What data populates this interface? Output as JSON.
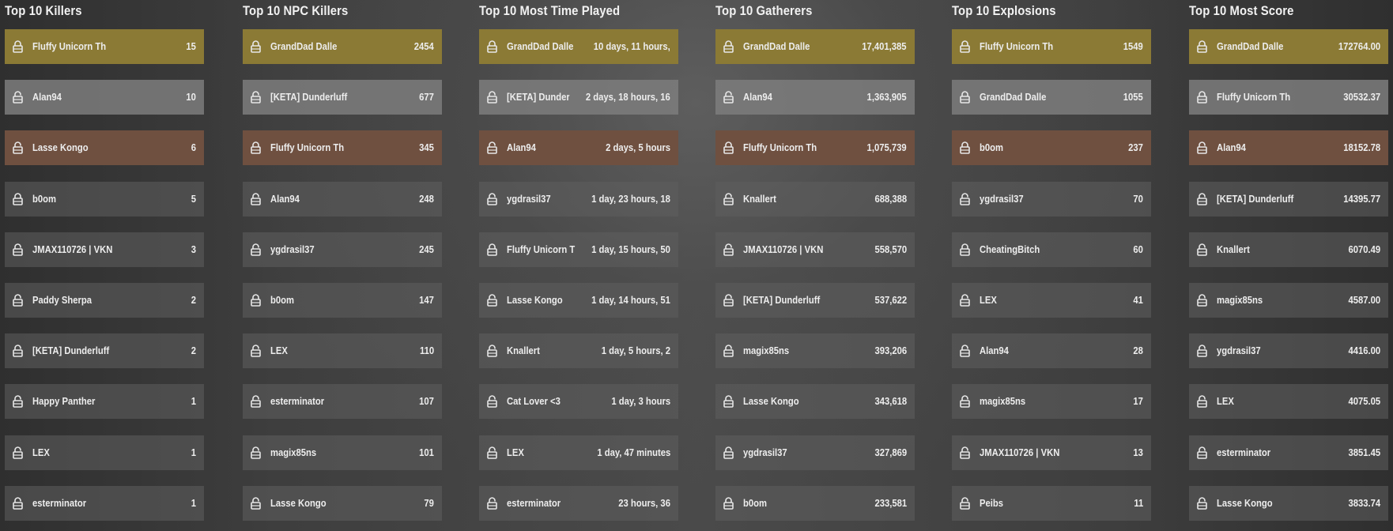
{
  "colors": {
    "gold": "#8b7a35",
    "silver": "#7d7d7d",
    "bronze": "#6f5040",
    "row_default": "#5a5a5a",
    "text": "#ededed"
  },
  "icons": {
    "locked": "lock-closed-icon",
    "unlocked": "lock-open-icon"
  },
  "leaderboards": [
    {
      "id": "killers",
      "title": "Top 10 Killers",
      "entries": [
        {
          "name": "Fluffy Unicorn Th",
          "value": "15",
          "locked": true
        },
        {
          "name": "Alan94",
          "value": "10",
          "locked": false
        },
        {
          "name": "Lasse Kongo",
          "value": "6",
          "locked": false
        },
        {
          "name": "b0om",
          "value": "5",
          "locked": true
        },
        {
          "name": "JMAX110726 | VKN",
          "value": "3",
          "locked": false
        },
        {
          "name": "Paddy Sherpa",
          "value": "2",
          "locked": false
        },
        {
          "name": "[KETA] Dunderluff",
          "value": "2",
          "locked": false
        },
        {
          "name": "Happy Panther",
          "value": "1",
          "locked": false
        },
        {
          "name": "LEX",
          "value": "1",
          "locked": false
        },
        {
          "name": "esterminator",
          "value": "1",
          "locked": false
        }
      ]
    },
    {
      "id": "npc-killers",
      "title": "Top 10 NPC Killers",
      "entries": [
        {
          "name": "GrandDad Dalle",
          "value": "2454",
          "locked": true
        },
        {
          "name": "[KETA] Dunderluff",
          "value": "677",
          "locked": false
        },
        {
          "name": "Fluffy Unicorn Th",
          "value": "345",
          "locked": true
        },
        {
          "name": "Alan94",
          "value": "248",
          "locked": false
        },
        {
          "name": "ygdrasil37",
          "value": "245",
          "locked": false
        },
        {
          "name": "b0om",
          "value": "147",
          "locked": true
        },
        {
          "name": "LEX",
          "value": "110",
          "locked": false
        },
        {
          "name": "esterminator",
          "value": "107",
          "locked": false
        },
        {
          "name": "magix85ns",
          "value": "101",
          "locked": false
        },
        {
          "name": "Lasse Kongo",
          "value": "79",
          "locked": false
        }
      ]
    },
    {
      "id": "time-played",
      "title": "Top 10 Most Time Played",
      "entries": [
        {
          "name": "GrandDad Dalle",
          "value": "10 days, 11 hours,",
          "locked": true
        },
        {
          "name": "[KETA] Dunderluff",
          "value": "2 days, 18 hours, 16",
          "locked": false
        },
        {
          "name": "Alan94",
          "value": "2 days, 5 hours",
          "locked": false
        },
        {
          "name": "ygdrasil37",
          "value": "1 day, 23 hours, 18",
          "locked": false
        },
        {
          "name": "Fluffy Unicorn Th",
          "value": "1 day, 15 hours, 50",
          "locked": true
        },
        {
          "name": "Lasse Kongo",
          "value": "1 day, 14 hours, 51",
          "locked": false
        },
        {
          "name": "Knallert",
          "value": "1 day, 5 hours, 2",
          "locked": false
        },
        {
          "name": "Cat Lover <3",
          "value": "1 day, 3 hours",
          "locked": false
        },
        {
          "name": "LEX",
          "value": "1 day, 47 minutes",
          "locked": false
        },
        {
          "name": "esterminator",
          "value": "23 hours, 36",
          "locked": false
        }
      ]
    },
    {
      "id": "gatherers",
      "title": "Top 10 Gatherers",
      "entries": [
        {
          "name": "GrandDad Dalle",
          "value": "17,401,385",
          "locked": true
        },
        {
          "name": "Alan94",
          "value": "1,363,905",
          "locked": false
        },
        {
          "name": "Fluffy Unicorn Th",
          "value": "1,075,739",
          "locked": true
        },
        {
          "name": "Knallert",
          "value": "688,388",
          "locked": false
        },
        {
          "name": "JMAX110726 | VKN",
          "value": "558,570",
          "locked": false
        },
        {
          "name": "[KETA] Dunderluff",
          "value": "537,622",
          "locked": false
        },
        {
          "name": "magix85ns",
          "value": "393,206",
          "locked": false
        },
        {
          "name": "Lasse Kongo",
          "value": "343,618",
          "locked": false
        },
        {
          "name": "ygdrasil37",
          "value": "327,869",
          "locked": false
        },
        {
          "name": "b0om",
          "value": "233,581",
          "locked": true
        }
      ]
    },
    {
      "id": "explosions",
      "title": "Top 10 Explosions",
      "entries": [
        {
          "name": "Fluffy Unicorn Th",
          "value": "1549",
          "locked": true
        },
        {
          "name": "GrandDad Dalle",
          "value": "1055",
          "locked": true
        },
        {
          "name": "b0om",
          "value": "237",
          "locked": true
        },
        {
          "name": "ygdrasil37",
          "value": "70",
          "locked": false
        },
        {
          "name": "CheatingBitch",
          "value": "60",
          "locked": true
        },
        {
          "name": "LEX",
          "value": "41",
          "locked": false
        },
        {
          "name": "Alan94",
          "value": "28",
          "locked": false
        },
        {
          "name": "magix85ns",
          "value": "17",
          "locked": false
        },
        {
          "name": "JMAX110726 | VKN",
          "value": "13",
          "locked": false
        },
        {
          "name": "Peibs",
          "value": "11",
          "locked": false
        }
      ]
    },
    {
      "id": "score",
      "title": "Top 10 Most Score",
      "entries": [
        {
          "name": "GrandDad Dalle",
          "value": "172764.00",
          "locked": true
        },
        {
          "name": "Fluffy Unicorn Th",
          "value": "30532.37",
          "locked": true
        },
        {
          "name": "Alan94",
          "value": "18152.78",
          "locked": false
        },
        {
          "name": "[KETA] Dunderluff",
          "value": "14395.77",
          "locked": false
        },
        {
          "name": "Knallert",
          "value": "6070.49",
          "locked": false
        },
        {
          "name": "magix85ns",
          "value": "4587.00",
          "locked": false
        },
        {
          "name": "ygdrasil37",
          "value": "4416.00",
          "locked": false
        },
        {
          "name": "LEX",
          "value": "4075.05",
          "locked": false
        },
        {
          "name": "esterminator",
          "value": "3851.45",
          "locked": false
        },
        {
          "name": "Lasse Kongo",
          "value": "3833.74",
          "locked": false
        }
      ]
    }
  ]
}
